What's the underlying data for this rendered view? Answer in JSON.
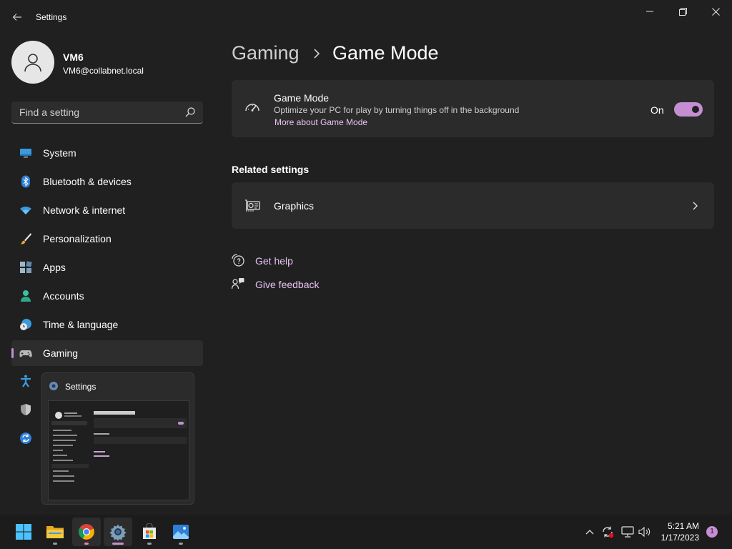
{
  "window": {
    "title": "Settings",
    "controls": {
      "minimize": "—",
      "maximize": "❐",
      "close": "✕"
    }
  },
  "profile": {
    "name": "VM6",
    "email": "VM6@collabnet.local"
  },
  "search": {
    "placeholder": "Find a setting"
  },
  "sidebar": {
    "items": [
      {
        "label": "System",
        "icon": "monitor-icon"
      },
      {
        "label": "Bluetooth & devices",
        "icon": "bluetooth-icon"
      },
      {
        "label": "Network & internet",
        "icon": "wifi-icon"
      },
      {
        "label": "Personalization",
        "icon": "brush-icon"
      },
      {
        "label": "Apps",
        "icon": "apps-icon"
      },
      {
        "label": "Accounts",
        "icon": "person-icon"
      },
      {
        "label": "Time & language",
        "icon": "globe-clock-icon"
      },
      {
        "label": "Gaming",
        "icon": "gamepad-icon",
        "selected": true
      }
    ],
    "hidden_icons": [
      "accessibility-icon",
      "shield-icon",
      "windows-update-icon"
    ]
  },
  "taskbar_preview": {
    "title": "Settings"
  },
  "breadcrumb": {
    "parent": "Gaming",
    "current": "Game Mode"
  },
  "game_mode": {
    "title": "Game Mode",
    "description": "Optimize your PC for play by turning things off in the background",
    "link": "More about Game Mode",
    "state_label": "On",
    "enabled": true
  },
  "related": {
    "heading": "Related settings",
    "items": [
      {
        "label": "Graphics"
      }
    ]
  },
  "help": {
    "get_help": "Get help",
    "give_feedback": "Give feedback"
  },
  "taskbar": {
    "apps": [
      "start-icon",
      "file-explorer-icon",
      "chrome-icon",
      "settings-icon",
      "store-icon",
      "photos-icon"
    ],
    "clock": {
      "time": "5:21 AM",
      "date": "1/17/2023"
    },
    "notification_count": "1"
  },
  "colors": {
    "accent": "#c58ed2",
    "link": "#e8c4f2",
    "background": "#202020",
    "card": "#2b2b2b"
  }
}
